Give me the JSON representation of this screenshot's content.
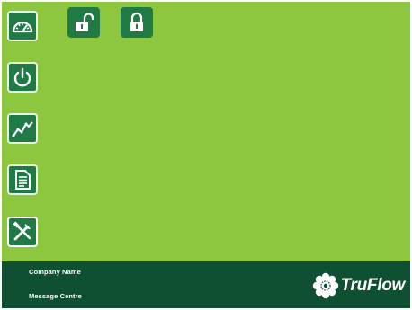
{
  "sidebar": {
    "items": [
      {
        "name": "dashboard",
        "icon": "gauge-icon"
      },
      {
        "name": "power",
        "icon": "power-icon"
      },
      {
        "name": "trends",
        "icon": "trend-chart-icon"
      },
      {
        "name": "reports",
        "icon": "document-icon"
      },
      {
        "name": "settings",
        "icon": "tools-icon",
        "active": true
      }
    ]
  },
  "toolbar": {
    "unlock_icon": "unlock-icon",
    "lock_icon": "lock-icon"
  },
  "footer": {
    "company_name": "Company Name",
    "message_centre": "Message Centre"
  },
  "brand": {
    "name": "TruFlow",
    "logo_icon": "flower-logo-icon"
  },
  "colors": {
    "background": "#8dc63f",
    "button": "#1f7a46",
    "footer": "#0f4f32",
    "text": "#ffffff"
  }
}
